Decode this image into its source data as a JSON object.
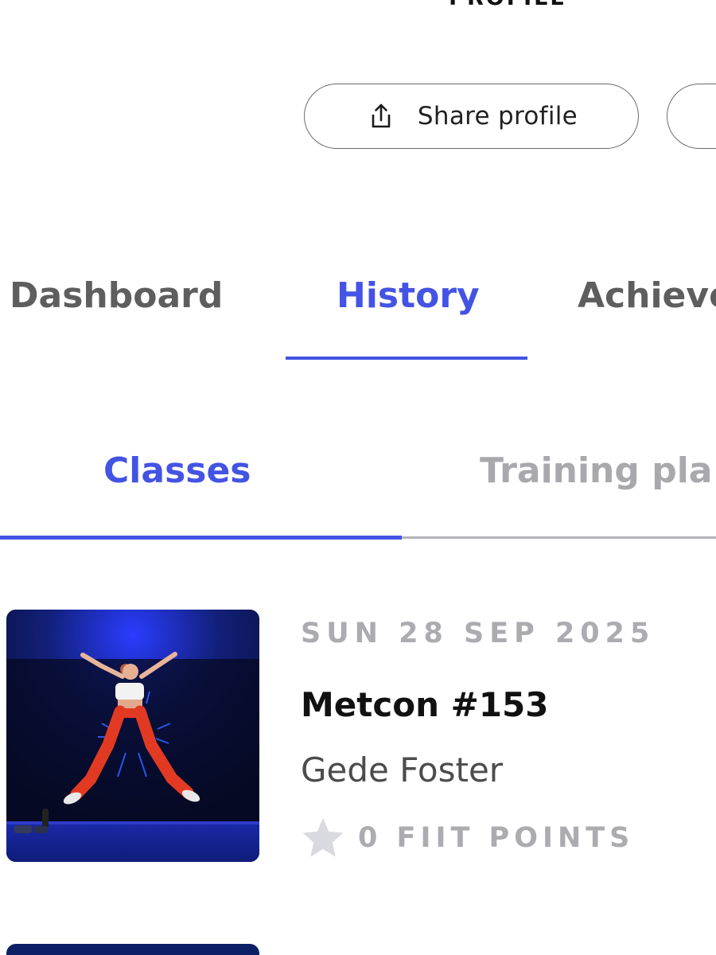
{
  "header": {
    "title": "PROFILE"
  },
  "actions": {
    "share_label": "Share profile",
    "share_icon": "share-upload-icon"
  },
  "main_tabs": [
    {
      "label": "Dashboard",
      "active": false
    },
    {
      "label": "History",
      "active": true
    },
    {
      "label": "Achieve",
      "active": false
    }
  ],
  "sub_tabs": [
    {
      "label": "Classes",
      "active": true
    },
    {
      "label": "Training pla",
      "active": false
    }
  ],
  "classes": [
    {
      "date": "SUN 28 SEP 2025",
      "title": "Metcon #153",
      "trainer": "Gede Foster",
      "points": "0 FIIT POINTS",
      "points_icon": "star-icon"
    }
  ],
  "colors": {
    "accent": "#4353e3",
    "muted": "#ababb0",
    "text_dark": "#111111",
    "text_secondary": "#4c4c4c"
  }
}
